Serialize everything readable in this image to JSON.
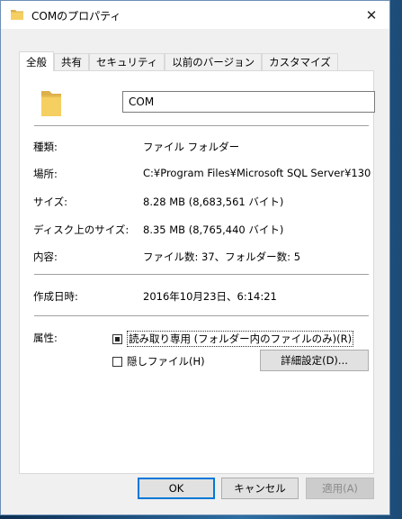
{
  "window": {
    "title": "COMのプロパティ",
    "close_glyph": "✕"
  },
  "tabs": [
    {
      "label": "全般",
      "active": true
    },
    {
      "label": "共有",
      "active": false
    },
    {
      "label": "セキュリティ",
      "active": false
    },
    {
      "label": "以前のバージョン",
      "active": false
    },
    {
      "label": "カスタマイズ",
      "active": false
    }
  ],
  "general": {
    "name": "COM",
    "type_label": "種類:",
    "type_value": "ファイル フォルダー",
    "location_label": "場所:",
    "location_value": "C:¥Program Files¥Microsoft SQL Server¥130",
    "size_label": "サイズ:",
    "size_value": "8.28 MB (8,683,561 バイト)",
    "disk_size_label": "ディスク上のサイズ:",
    "disk_size_value": "8.35 MB (8,765,440 バイト)",
    "contents_label": "内容:",
    "contents_value": "ファイル数: 37、フォルダー数: 5",
    "created_label": "作成日時:",
    "created_value": "2016年10月23日、6:14:21",
    "attributes_label": "属性:",
    "readonly_label": "読み取り専用 (フォルダー内のファイルのみ)(R)",
    "hidden_label": "隠しファイル(H)",
    "advanced_button": "詳細設定(D)..."
  },
  "footer": {
    "ok": "OK",
    "cancel": "キャンセル",
    "apply": "適用(A)"
  },
  "colors": {
    "folder": "#f2c94c",
    "accent": "#0078d7"
  }
}
